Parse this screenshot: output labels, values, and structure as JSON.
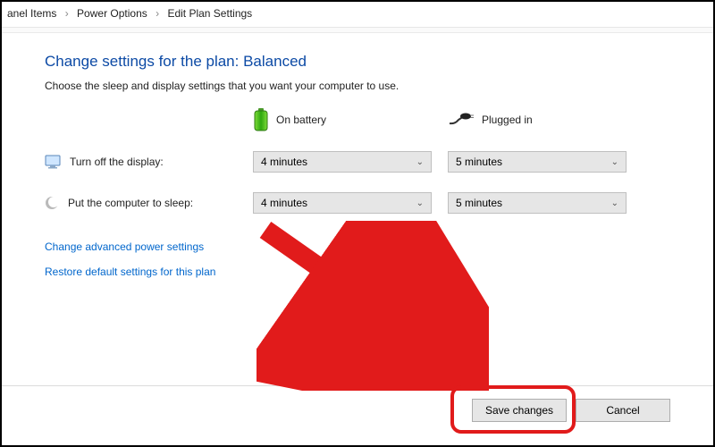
{
  "breadcrumb": {
    "items": [
      "anel Items",
      "Power Options",
      "Edit Plan Settings"
    ]
  },
  "title": "Change settings for the plan: Balanced",
  "subtitle": "Choose the sleep and display settings that you want your computer to use.",
  "columns": {
    "battery": "On battery",
    "plugged": "Plugged in"
  },
  "rows": {
    "display": {
      "label": "Turn off the display:",
      "battery_value": "4 minutes",
      "plugged_value": "5 minutes"
    },
    "sleep": {
      "label": "Put the computer to sleep:",
      "battery_value": "4 minutes",
      "plugged_value": "5 minutes"
    }
  },
  "links": {
    "advanced": "Change advanced power settings",
    "restore": "Restore default settings for this plan"
  },
  "buttons": {
    "save": "Save changes",
    "cancel": "Cancel"
  }
}
